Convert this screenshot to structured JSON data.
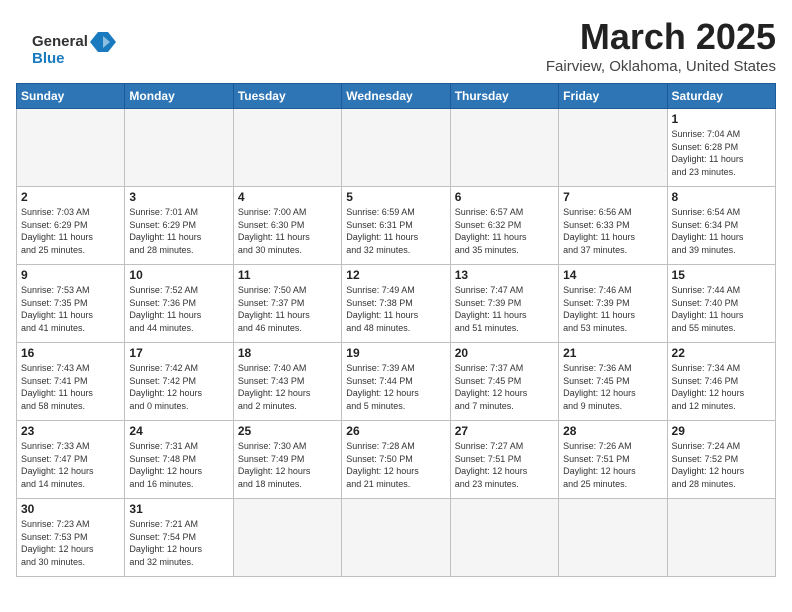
{
  "logo": {
    "line1": "General",
    "line2": "Blue"
  },
  "header": {
    "title": "March 2025",
    "subtitle": "Fairview, Oklahoma, United States"
  },
  "weekdays": [
    "Sunday",
    "Monday",
    "Tuesday",
    "Wednesday",
    "Thursday",
    "Friday",
    "Saturday"
  ],
  "weeks": [
    [
      {
        "day": "",
        "info": ""
      },
      {
        "day": "",
        "info": ""
      },
      {
        "day": "",
        "info": ""
      },
      {
        "day": "",
        "info": ""
      },
      {
        "day": "",
        "info": ""
      },
      {
        "day": "",
        "info": ""
      },
      {
        "day": "1",
        "info": "Sunrise: 7:04 AM\nSunset: 6:28 PM\nDaylight: 11 hours\nand 23 minutes."
      }
    ],
    [
      {
        "day": "2",
        "info": "Sunrise: 7:03 AM\nSunset: 6:29 PM\nDaylight: 11 hours\nand 25 minutes."
      },
      {
        "day": "3",
        "info": "Sunrise: 7:01 AM\nSunset: 6:29 PM\nDaylight: 11 hours\nand 28 minutes."
      },
      {
        "day": "4",
        "info": "Sunrise: 7:00 AM\nSunset: 6:30 PM\nDaylight: 11 hours\nand 30 minutes."
      },
      {
        "day": "5",
        "info": "Sunrise: 6:59 AM\nSunset: 6:31 PM\nDaylight: 11 hours\nand 32 minutes."
      },
      {
        "day": "6",
        "info": "Sunrise: 6:57 AM\nSunset: 6:32 PM\nDaylight: 11 hours\nand 35 minutes."
      },
      {
        "day": "7",
        "info": "Sunrise: 6:56 AM\nSunset: 6:33 PM\nDaylight: 11 hours\nand 37 minutes."
      },
      {
        "day": "8",
        "info": "Sunrise: 6:54 AM\nSunset: 6:34 PM\nDaylight: 11 hours\nand 39 minutes."
      }
    ],
    [
      {
        "day": "9",
        "info": "Sunrise: 7:53 AM\nSunset: 7:35 PM\nDaylight: 11 hours\nand 41 minutes."
      },
      {
        "day": "10",
        "info": "Sunrise: 7:52 AM\nSunset: 7:36 PM\nDaylight: 11 hours\nand 44 minutes."
      },
      {
        "day": "11",
        "info": "Sunrise: 7:50 AM\nSunset: 7:37 PM\nDaylight: 11 hours\nand 46 minutes."
      },
      {
        "day": "12",
        "info": "Sunrise: 7:49 AM\nSunset: 7:38 PM\nDaylight: 11 hours\nand 48 minutes."
      },
      {
        "day": "13",
        "info": "Sunrise: 7:47 AM\nSunset: 7:39 PM\nDaylight: 11 hours\nand 51 minutes."
      },
      {
        "day": "14",
        "info": "Sunrise: 7:46 AM\nSunset: 7:39 PM\nDaylight: 11 hours\nand 53 minutes."
      },
      {
        "day": "15",
        "info": "Sunrise: 7:44 AM\nSunset: 7:40 PM\nDaylight: 11 hours\nand 55 minutes."
      }
    ],
    [
      {
        "day": "16",
        "info": "Sunrise: 7:43 AM\nSunset: 7:41 PM\nDaylight: 11 hours\nand 58 minutes."
      },
      {
        "day": "17",
        "info": "Sunrise: 7:42 AM\nSunset: 7:42 PM\nDaylight: 12 hours\nand 0 minutes."
      },
      {
        "day": "18",
        "info": "Sunrise: 7:40 AM\nSunset: 7:43 PM\nDaylight: 12 hours\nand 2 minutes."
      },
      {
        "day": "19",
        "info": "Sunrise: 7:39 AM\nSunset: 7:44 PM\nDaylight: 12 hours\nand 5 minutes."
      },
      {
        "day": "20",
        "info": "Sunrise: 7:37 AM\nSunset: 7:45 PM\nDaylight: 12 hours\nand 7 minutes."
      },
      {
        "day": "21",
        "info": "Sunrise: 7:36 AM\nSunset: 7:45 PM\nDaylight: 12 hours\nand 9 minutes."
      },
      {
        "day": "22",
        "info": "Sunrise: 7:34 AM\nSunset: 7:46 PM\nDaylight: 12 hours\nand 12 minutes."
      }
    ],
    [
      {
        "day": "23",
        "info": "Sunrise: 7:33 AM\nSunset: 7:47 PM\nDaylight: 12 hours\nand 14 minutes."
      },
      {
        "day": "24",
        "info": "Sunrise: 7:31 AM\nSunset: 7:48 PM\nDaylight: 12 hours\nand 16 minutes."
      },
      {
        "day": "25",
        "info": "Sunrise: 7:30 AM\nSunset: 7:49 PM\nDaylight: 12 hours\nand 18 minutes."
      },
      {
        "day": "26",
        "info": "Sunrise: 7:28 AM\nSunset: 7:50 PM\nDaylight: 12 hours\nand 21 minutes."
      },
      {
        "day": "27",
        "info": "Sunrise: 7:27 AM\nSunset: 7:51 PM\nDaylight: 12 hours\nand 23 minutes."
      },
      {
        "day": "28",
        "info": "Sunrise: 7:26 AM\nSunset: 7:51 PM\nDaylight: 12 hours\nand 25 minutes."
      },
      {
        "day": "29",
        "info": "Sunrise: 7:24 AM\nSunset: 7:52 PM\nDaylight: 12 hours\nand 28 minutes."
      }
    ],
    [
      {
        "day": "30",
        "info": "Sunrise: 7:23 AM\nSunset: 7:53 PM\nDaylight: 12 hours\nand 30 minutes."
      },
      {
        "day": "31",
        "info": "Sunrise: 7:21 AM\nSunset: 7:54 PM\nDaylight: 12 hours\nand 32 minutes."
      },
      {
        "day": "",
        "info": ""
      },
      {
        "day": "",
        "info": ""
      },
      {
        "day": "",
        "info": ""
      },
      {
        "day": "",
        "info": ""
      },
      {
        "day": "",
        "info": ""
      }
    ]
  ]
}
